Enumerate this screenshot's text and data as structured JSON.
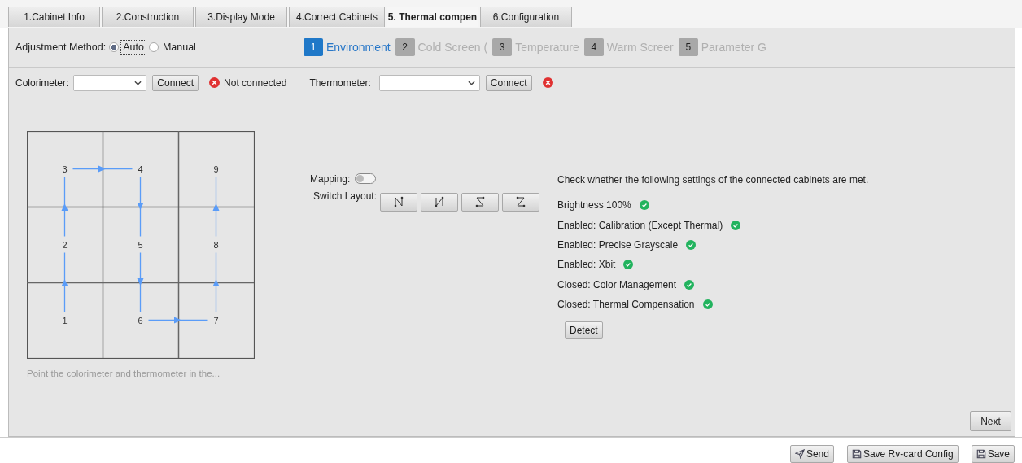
{
  "tabs": [
    {
      "label": "1.Cabinet Info",
      "selected": false
    },
    {
      "label": "2.Construction",
      "selected": false
    },
    {
      "label": "3.Display Mode",
      "selected": false
    },
    {
      "label": "4.Correct Cabinets",
      "selected": false
    },
    {
      "label": "5. Thermal compen",
      "selected": true
    },
    {
      "label": "6.Configuration",
      "selected": false
    }
  ],
  "adjustment": {
    "label": "Adjustment Method:",
    "options": [
      {
        "label": "Auto",
        "selected": true
      },
      {
        "label": "Manual",
        "selected": false
      }
    ]
  },
  "steps": [
    {
      "number": "1",
      "label": "Environment",
      "selected": true
    },
    {
      "number": "2",
      "label": "Cold Screen (",
      "selected": false
    },
    {
      "number": "3",
      "label": "Temperature",
      "selected": false
    },
    {
      "number": "4",
      "label": "Warm Screer",
      "selected": false
    },
    {
      "number": "5",
      "label": "Parameter G",
      "selected": false
    }
  ],
  "colorimeter": {
    "label": "Colorimeter:",
    "button": "Connect",
    "connected": false,
    "status": "Not connected"
  },
  "thermometer": {
    "label": "Thermometer:",
    "button": "Connect",
    "connected": false
  },
  "cabinet_grid": {
    "rows": [
      {
        "cells": [
          {
            "label": "3"
          },
          {
            "label": "4"
          },
          {
            "label": "9"
          }
        ]
      },
      {
        "cells": [
          {
            "label": "2"
          },
          {
            "label": "5"
          },
          {
            "label": "8"
          }
        ]
      },
      {
        "cells": [
          {
            "label": "1"
          },
          {
            "label": "6"
          },
          {
            "label": "7"
          }
        ]
      }
    ],
    "hint": "Point the colorimeter and thermometer in the..."
  },
  "mapping": {
    "label": "Mapping:",
    "on": false
  },
  "switch_layout": {
    "label": "Switch Layout:"
  },
  "checks": {
    "intro": "Check whether the following settings of the connected cabinets are met.",
    "items": [
      {
        "label": "Brightness 100%",
        "ok": true
      },
      {
        "label": "Enabled: Calibration (Except Thermal)",
        "ok": true
      },
      {
        "label": "Enabled: Precise Grayscale",
        "ok": true
      },
      {
        "label": "Enabled: Xbit",
        "ok": true
      },
      {
        "label": "Closed: Color Management",
        "ok": true
      },
      {
        "label": "Closed: Thermal Compensation",
        "ok": true
      }
    ],
    "button": "Detect"
  },
  "next_button": "Next",
  "footer": [
    {
      "label": "Send",
      "kind": "send"
    },
    {
      "label": "Save Rv-card Config",
      "kind": "save"
    },
    {
      "label": "Save",
      "kind": "save"
    }
  ]
}
